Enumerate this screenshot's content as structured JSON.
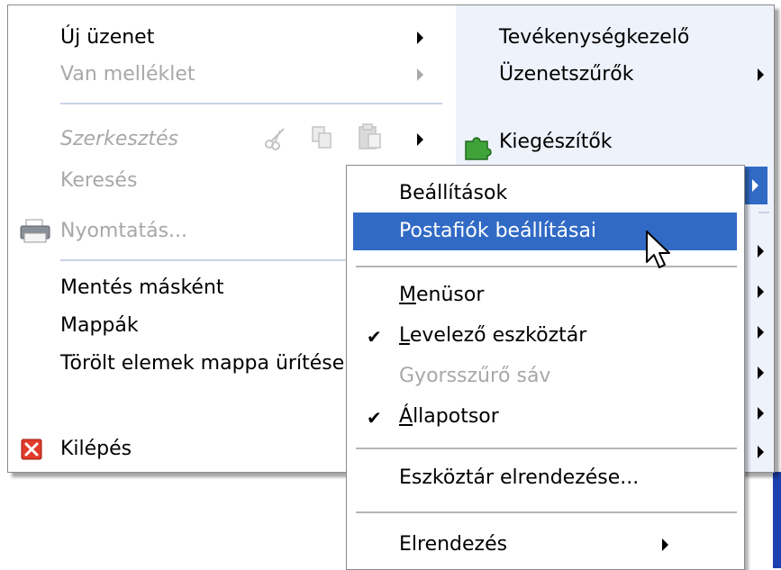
{
  "main_menu": {
    "items": [
      {
        "label": "Új üzenet"
      },
      {
        "label": "Van melléklet"
      },
      {
        "label": "Szerkesztés"
      },
      {
        "label": "Keresés"
      },
      {
        "label": "Nyomtatás..."
      },
      {
        "label": "Mentés másként"
      },
      {
        "label": "Mappák"
      },
      {
        "label": "Törölt elemek mappa ürítése"
      },
      {
        "label": "Kilépés"
      }
    ]
  },
  "right_column": {
    "items": [
      {
        "label": "Tevékenységkezelő"
      },
      {
        "label": "Üzenetszűrők"
      },
      {
        "label": "Kiegészítők"
      }
    ]
  },
  "submenu": {
    "items": [
      {
        "label": "Beállítások"
      },
      {
        "label": "Postafiók beállításai"
      },
      {
        "label_accel": "M",
        "label_rest": "enüsor"
      },
      {
        "label_accel": "L",
        "label_rest": "evelező eszköztár"
      },
      {
        "label": "Gyorsszűrő sáv"
      },
      {
        "label_accel": "Á",
        "label_rest": "llapotsor"
      },
      {
        "label": "Eszköztár elrendezése..."
      },
      {
        "label": "Elrendezés"
      }
    ],
    "checkmark": "✔"
  },
  "colors": {
    "highlight": "#316ac5",
    "right_column_bg": "#eef2fb",
    "disabled_text": "#a8a8a8"
  }
}
